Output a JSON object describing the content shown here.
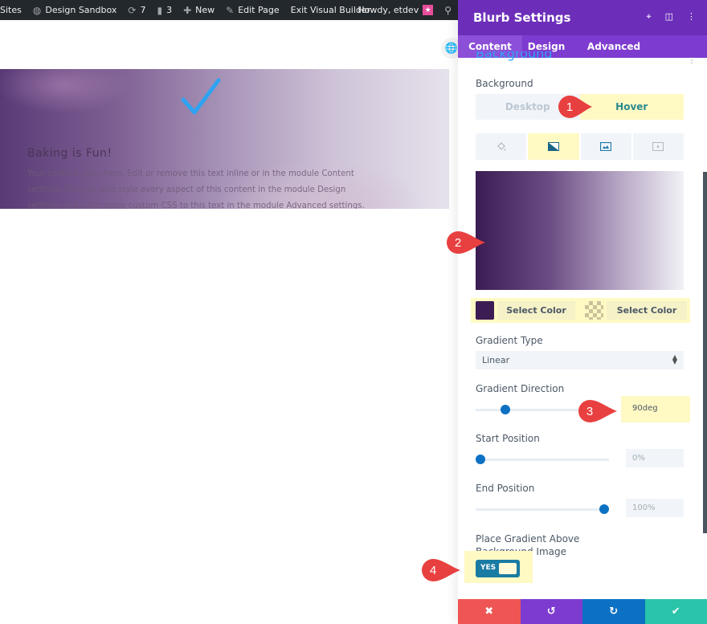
{
  "adminbar": {
    "items": [
      {
        "icon": "sites",
        "label": "Sites"
      },
      {
        "icon": "dashboard-icon",
        "label": "Design Sandbox"
      },
      {
        "icon": "updates-icon",
        "label": "7"
      },
      {
        "icon": "comment-icon",
        "label": "3"
      },
      {
        "icon": "plus-icon",
        "label": "New"
      },
      {
        "icon": "pencil-icon",
        "label": "Edit Page"
      },
      {
        "icon": "",
        "label": "Exit Visual Builder"
      }
    ],
    "greeting": "Howdy, etdev",
    "search_icon": "search-icon"
  },
  "blurb": {
    "title": "Baking is Fun!",
    "body": "Your content goes here. Edit or remove this text inline or in the module Content settings. You can also style every aspect of this content in the module Design settings and even apply custom CSS to this text in the module Advanced settings.",
    "icon_color": "#2ea3f2"
  },
  "panel": {
    "title": "Blurb Settings",
    "header_icons": [
      "focus-icon",
      "split-view-icon",
      "more-icon"
    ],
    "tabs": [
      {
        "label": "Content",
        "active": true
      },
      {
        "label": "Design",
        "active": false
      },
      {
        "label": "Advanced",
        "active": false
      }
    ],
    "section_title": "Background",
    "background_label": "Background",
    "modes": {
      "desktop": "Desktop",
      "hover": "Hover",
      "active": "Hover"
    },
    "bg_types": [
      "color-icon",
      "gradient-icon",
      "image-icon",
      "video-icon"
    ],
    "bg_type_active": "gradient",
    "gradient": {
      "start_color": "#3b1c53",
      "end_color": "transparent",
      "start_label": "Select Color",
      "end_label": "Select Color"
    },
    "gradient_type": {
      "label": "Gradient Type",
      "value": "Linear"
    },
    "gradient_direction": {
      "label": "Gradient Direction",
      "value": "90deg",
      "slider_fraction": 0.25
    },
    "start_position": {
      "label": "Start Position",
      "value": "0%",
      "slider_fraction": 0.0
    },
    "end_position": {
      "label": "End Position",
      "value": "100%",
      "slider_fraction": 1.0
    },
    "place_above": {
      "label_line1": "Place Gradient Above",
      "label_line2": "Background Image",
      "toggle": "YES"
    },
    "footer": [
      "close-icon",
      "undo-icon",
      "redo-icon",
      "save-check-icon"
    ],
    "footer_colors": [
      "#ef5555",
      "#7e3bd0",
      "#0c71c3",
      "#29c4a9"
    ]
  },
  "callouts": [
    "1",
    "2",
    "3",
    "4"
  ],
  "colors": {
    "panel_header": "#6c2eb9",
    "tab_bar": "#7e3bd0",
    "highlight": "#fff9c4",
    "callout": "#e84040"
  }
}
